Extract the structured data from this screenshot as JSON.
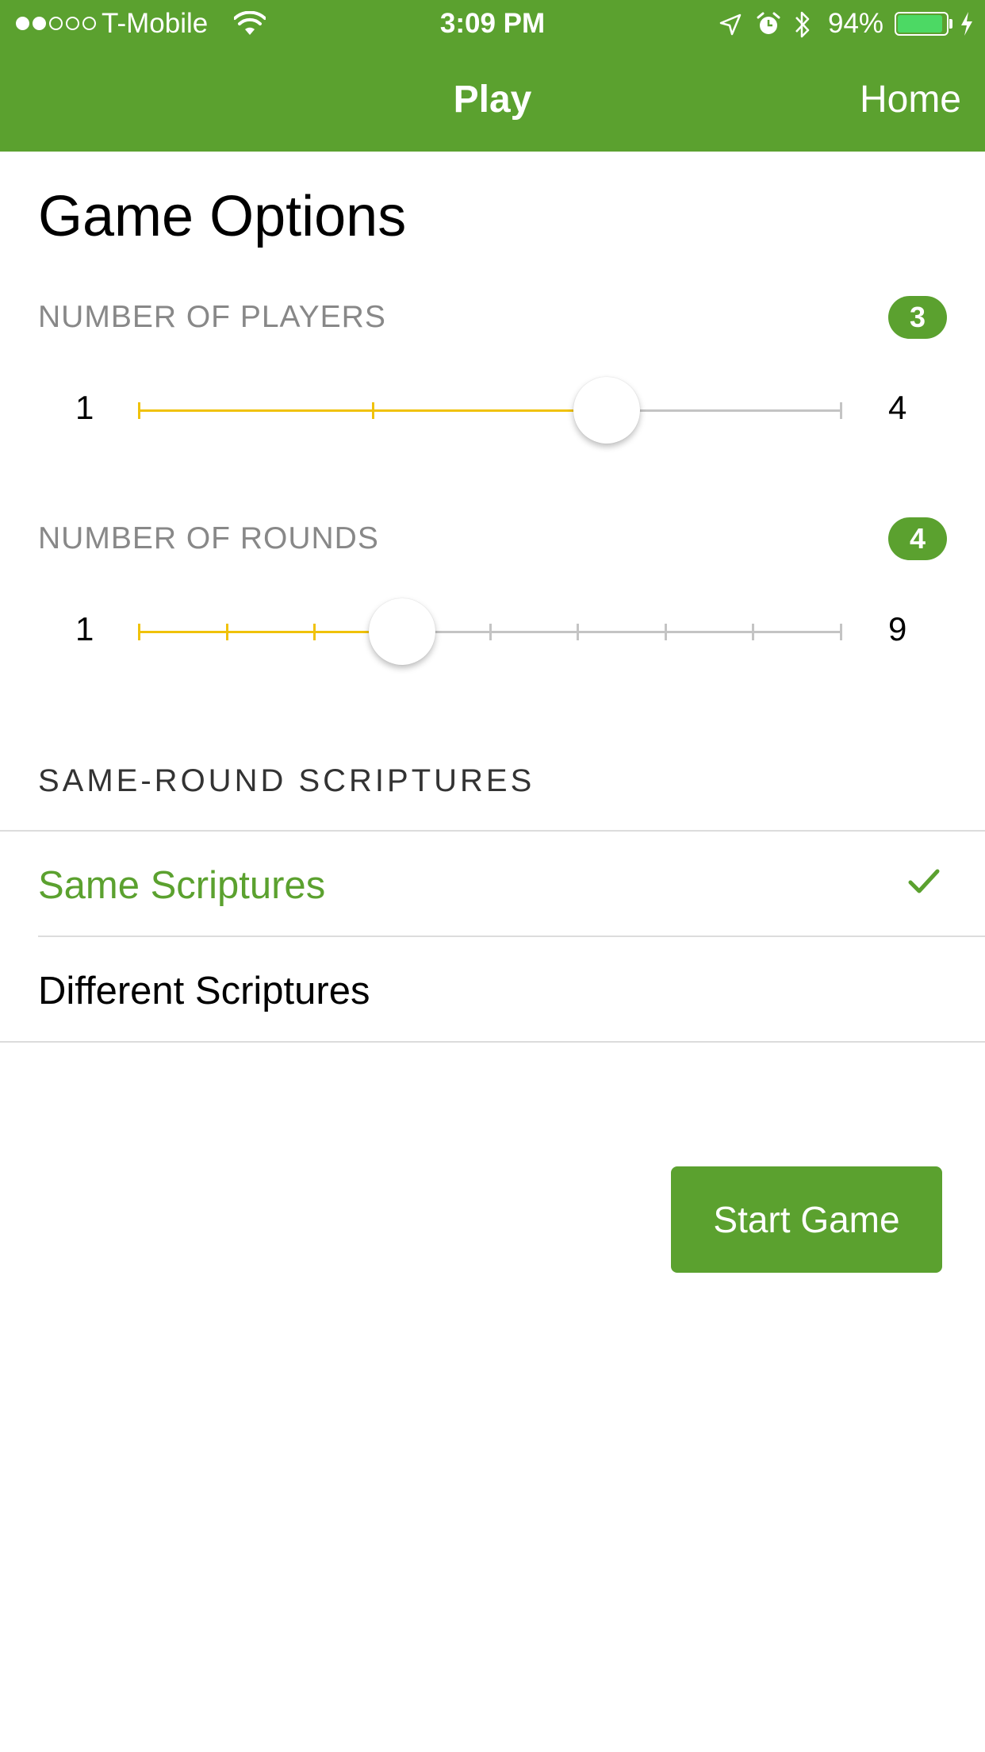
{
  "status_bar": {
    "carrier": "T-Mobile",
    "time": "3:09 PM",
    "battery_percent": "94%",
    "signal_bars_filled": 2,
    "signal_bars_total": 5
  },
  "nav": {
    "title": "Play",
    "home_label": "Home"
  },
  "page_title": "Game Options",
  "players": {
    "label": "NUMBER OF PLAYERS",
    "value": "3",
    "min": "1",
    "max": "4"
  },
  "rounds": {
    "label": "NUMBER OF ROUNDS",
    "value": "4",
    "min": "1",
    "max": "9"
  },
  "scriptures": {
    "label": "SAME-ROUND SCRIPTURES",
    "options": [
      {
        "label": "Same Scriptures",
        "selected": true
      },
      {
        "label": "Different Scriptures",
        "selected": false
      }
    ]
  },
  "start_button_label": "Start Game",
  "colors": {
    "brand_green": "#5ba12f",
    "slider_active": "#f0c20a",
    "slider_inactive": "#c4c4c4"
  },
  "icons": [
    "wifi-icon",
    "location-arrow-icon",
    "alarm-icon",
    "bluetooth-icon",
    "battery-icon",
    "charging-bolt-icon",
    "checkmark-icon"
  ]
}
